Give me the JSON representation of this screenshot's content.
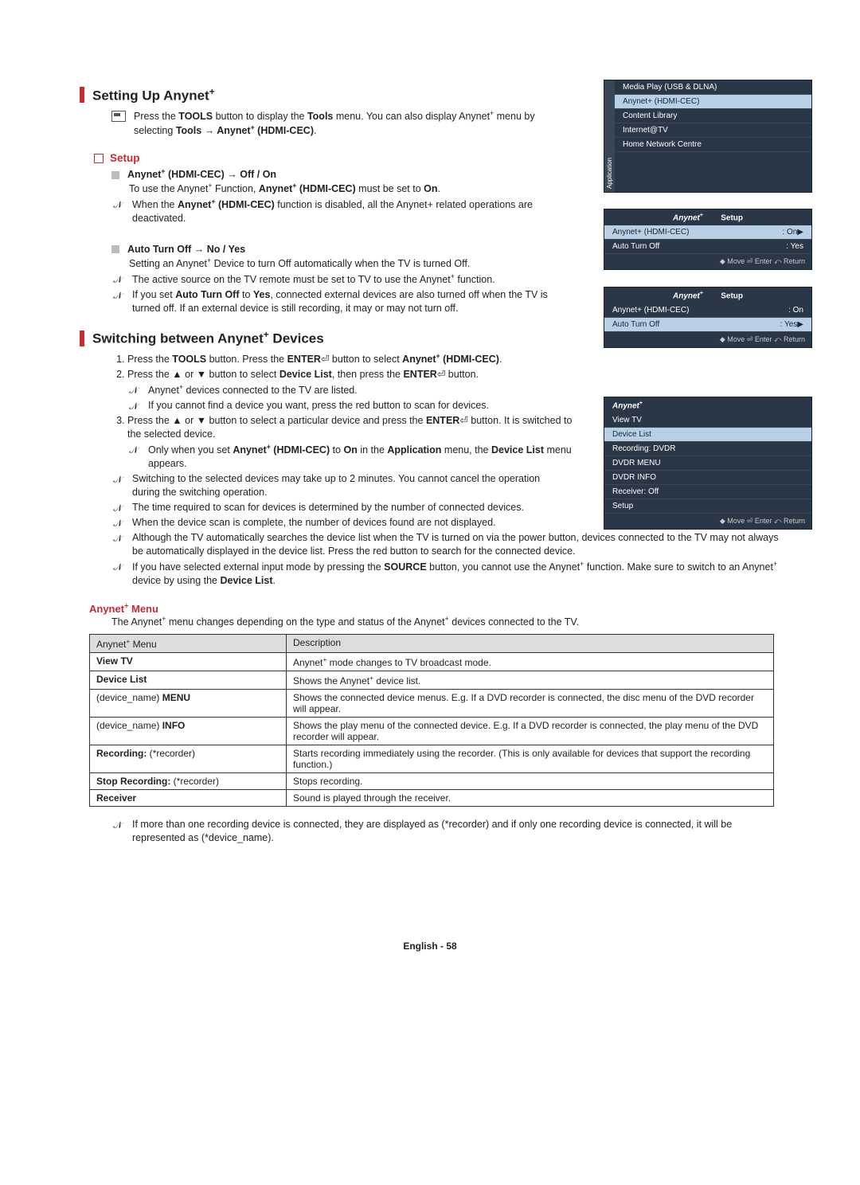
{
  "head1": "Setting Up Anynet",
  "head1_sup": "+",
  "head2": "Switching between Anynet",
  "head2_sup": "+",
  "head2_tail": " Devices",
  "tools_intro_a": "Press the ",
  "tools_intro_b": "TOOLS",
  "tools_intro_c": " button to display the ",
  "tools_intro_d": "Tools",
  "tools_intro_e": " menu. You can also display Anynet",
  "tools_intro_f": "+",
  "tools_intro_g": " menu by selecting ",
  "tools_intro_h": "Tools → Anynet",
  "tools_intro_i": "+",
  "tools_intro_j": " (HDMI-CEC)",
  "tools_intro_k": ".",
  "setup_label": "Setup",
  "item1_title": "Anynet",
  "item1_sup": "+",
  "item1_rest": " (HDMI-CEC) → Off / On",
  "item1_body_a": "To use the Anynet",
  "item1_body_b": "+",
  "item1_body_c": " Function, ",
  "item1_body_d": "Anynet",
  "item1_body_e": "+",
  "item1_body_f": " (HDMI-CEC)",
  "item1_body_g": " must be set to ",
  "item1_body_h": "On",
  "item1_body_i": ".",
  "item1_note_a": "When the ",
  "item1_note_b": "Anynet",
  "item1_note_c": "+",
  "item1_note_d": " (HDMI-CEC)",
  "item1_note_e": " function is disabled, all the Anynet+ related operations are deactivated.",
  "item2_title": "Auto Turn Off → No / Yes",
  "item2_body": "Setting an Anynet",
  "item2_body_sup": "+",
  "item2_body_tail": " Device to turn Off automatically when the TV is turned Off.",
  "item2_note1": "The active source on the TV remote must be set to TV to use the Anynet",
  "item2_note1_sup": "+",
  "item2_note1_tail": " function.",
  "item2_note2_a": "If you set ",
  "item2_note2_b": "Auto Turn Off",
  "item2_note2_c": " to ",
  "item2_note2_d": "Yes",
  "item2_note2_e": ", connected external devices are also turned off when the TV is turned off. If an external device is still recording, it may or may not turn off.",
  "sw1_a": "Press the ",
  "sw1_b": "TOOLS",
  "sw1_c": " button. Press the ",
  "sw1_d": "ENTER",
  "sw1_e": " button to select ",
  "sw1_f": "Anynet",
  "sw1_g": "+",
  "sw1_h": " (HDMI-CEC)",
  "sw1_i": ".",
  "sw2_a": "Press the ▲ or ▼ button to select ",
  "sw2_b": "Device List",
  "sw2_c": ", then press the ",
  "sw2_d": "ENTER",
  "sw2_e": " button.",
  "sw2_n1": "Anynet",
  "sw2_n1_sup": "+",
  "sw2_n1_tail": " devices connected to the TV are listed.",
  "sw2_n2": "If you cannot find a device you want, press the red button to scan for devices.",
  "sw3_a": "Press the ▲ or ▼ button to select a particular device and press the ",
  "sw3_b": "ENTER",
  "sw3_c": " button. It is switched to the selected device.",
  "sw3_n1_a": "Only when you set ",
  "sw3_n1_b": "Anynet",
  "sw3_n1_c": "+",
  "sw3_n1_d": " (HDMI-CEC)",
  "sw3_n1_e": " to ",
  "sw3_n1_f": "On",
  "sw3_n1_g": " in the ",
  "sw3_n1_h": "Application",
  "sw3_n1_i": " menu, the ",
  "sw3_n1_j": "Device List",
  "sw3_n1_k": " menu appears.",
  "gn1": "Switching to the selected devices may take up to 2 minutes. You cannot cancel the operation during the switching operation.",
  "gn2": "The time required to scan for devices is determined by the number of connected devices.",
  "gn3": "When the device scan is complete, the number of devices found are not displayed.",
  "gn4": "Although the TV automatically searches the device list when the TV is turned on via the power button, devices connected to the TV may not always be automatically displayed in the device list. Press the red button to search for the connected device.",
  "gn5_a": "If you have selected external input mode by pressing the ",
  "gn5_b": "SOURCE",
  "gn5_c": " button, you cannot use the Anynet",
  "gn5_d": "+",
  "gn5_e": " function. Make sure to switch to an Anynet",
  "gn5_f": "+",
  "gn5_g": " device by using the ",
  "gn5_h": "Device List",
  "gn5_i": ".",
  "menu_head": "Anynet",
  "menu_head_sup": "+",
  "menu_head_tail": " Menu",
  "menu_intro_a": "The Anynet",
  "menu_intro_b": "+",
  "menu_intro_c": " menu changes depending on the type and status of the Anynet",
  "menu_intro_d": "+",
  "menu_intro_e": " devices connected to the TV.",
  "th1_a": "Anynet",
  "th1_b": "+",
  "th1_c": " Menu",
  "th2": "Description",
  "r1a": "View TV",
  "r1b_a": "Anynet",
  "r1b_b": "+",
  "r1b_c": " mode changes to TV broadcast mode.",
  "r2a": "Device List",
  "r2b_a": "Shows the Anynet",
  "r2b_b": "+",
  "r2b_c": " device list.",
  "r3a_a": "(device_name) ",
  "r3a_b": "MENU",
  "r3b": "Shows the connected device menus. E.g. If a DVD recorder is connected, the disc menu of the DVD recorder will appear.",
  "r4a_a": "(device_name) ",
  "r4a_b": "INFO",
  "r4b": "Shows the play menu of the connected device. E.g. If a DVD recorder is connected, the play menu of the DVD recorder will appear.",
  "r5a_a": "Recording: ",
  "r5a_b": "(*recorder)",
  "r5b": "Starts recording immediately using the recorder. (This is only available for devices that support the recording function.)",
  "r6a_a": "Stop Recording: ",
  "r6a_b": "(*recorder)",
  "r6b": "Stops recording.",
  "r7a": "Receiver",
  "r7b": "Sound is played through the receiver.",
  "post_note": "If more than one recording device is connected, they are displayed as (*recorder) and if only one recording device is connected, it will be represented as (*device_name).",
  "footer_a": "English - ",
  "footer_b": "58",
  "osd1": {
    "app_tab": "Application",
    "items": [
      "Media Play (USB & DLNA)",
      "Anynet+ (HDMI-CEC)",
      "Content Library",
      "Internet@TV",
      "Home Network Centre"
    ]
  },
  "osd2": {
    "brand": "Anynet",
    "title": "Setup",
    "row1a": "Anynet+ (HDMI-CEC)",
    "row1b": ": On",
    "row2a": "Auto Turn Off",
    "row2b": ": Yes",
    "ft": "◆ Move    ⏎ Enter    ⤺ Return"
  },
  "osd3": {
    "brand": "Anynet",
    "items": [
      "View TV",
      "Device List",
      "Recording: DVDR",
      "DVDR MENU",
      "DVDR INFO",
      "Receiver: Off",
      "Setup"
    ],
    "ft": "◆ Move    ⏎ Enter    ⤺ Return"
  },
  "enter_glyph": "⏎"
}
